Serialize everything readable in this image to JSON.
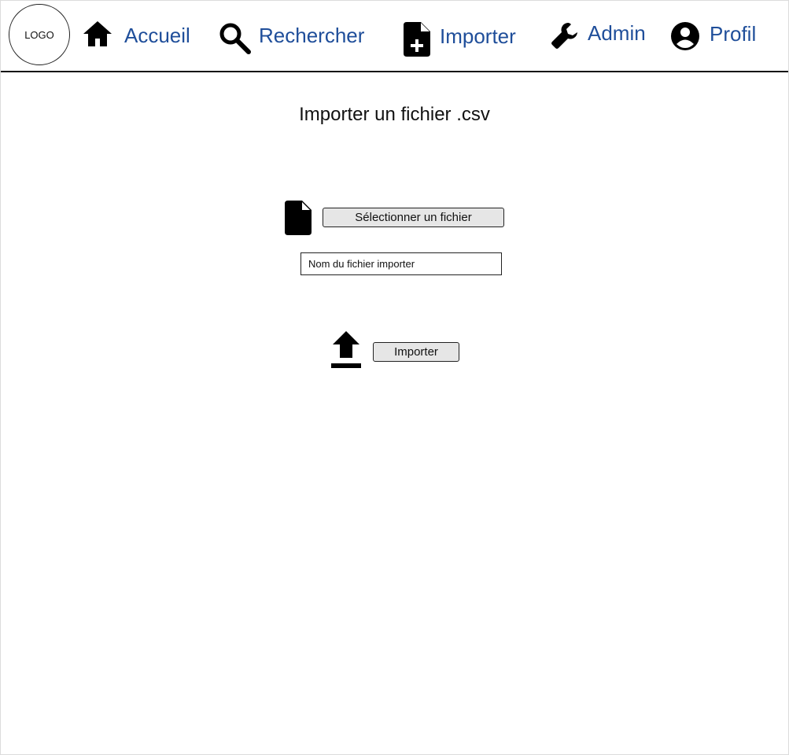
{
  "header": {
    "logo_text": "LOGO",
    "nav": [
      {
        "label": "Accueil",
        "icon": "home-icon"
      },
      {
        "label": "Rechercher",
        "icon": "search-icon"
      },
      {
        "label": "Importer",
        "icon": "file-add-icon"
      },
      {
        "label": "Admin",
        "icon": "wrench-icon"
      },
      {
        "label": "Profil",
        "icon": "account-circle-icon"
      }
    ]
  },
  "main": {
    "title": "Importer un fichier .csv",
    "file_icon": "file-icon",
    "select_button_label": "Sélectionner un fichier",
    "filename_placeholder": "Nom du fichier importer",
    "upload_icon": "upload-icon",
    "import_button_label": "Importer"
  },
  "colors": {
    "nav_link": "#1f4e9a",
    "button_bg": "#e6e6e6",
    "text": "#111111"
  }
}
